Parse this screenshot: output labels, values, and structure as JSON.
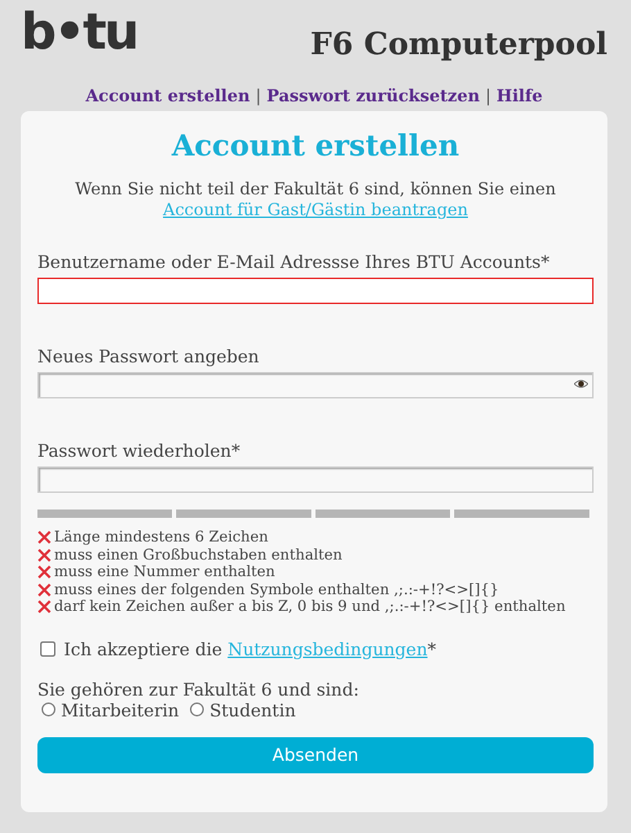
{
  "header": {
    "logo": "b•tu",
    "title": "F6 Computerpool"
  },
  "nav": [
    {
      "kind": "link",
      "text": "Account erstellen"
    },
    {
      "kind": "separator",
      "text": "|"
    },
    {
      "kind": "link",
      "text": "Passwort zurücksetzen"
    },
    {
      "kind": "separator",
      "text": "|"
    },
    {
      "kind": "link",
      "text": "Hilfe"
    }
  ],
  "form": {
    "title": "Account erstellen",
    "intro": {
      "text": "Wenn Sie nicht teil der Fakultät 6 sind, können Sie einen",
      "link": "Account für Gast/Gästin beantragen"
    },
    "fields": [
      {
        "label": "Benutzername oder E-Mail Adressse Ihres BTU Accounts*",
        "error": true,
        "show_toggle": false
      },
      {
        "label": "Neues Passwort angeben",
        "error": false,
        "show_toggle": true
      },
      {
        "label": "Passwort wiederholen*",
        "error": false,
        "show_toggle": false
      }
    ],
    "requirements": [
      {
        "text": "Länge mindestens 6 Zeichen",
        "met": false
      },
      {
        "text": "muss einen Großbuchstaben enthalten",
        "met": false
      },
      {
        "text": "muss eine Nummer enthalten",
        "met": false
      },
      {
        "text": "muss eines der folgenden Symbole enthalten ,;.:-+!?<>[]{}",
        "met": false
      },
      {
        "text": "darf kein Zeichen außer a bis Z, 0 bis 9 und ,;.:-+!?<>[]{} enthalten",
        "met": false
      }
    ],
    "terms": {
      "checked": false,
      "text": "Ich akzeptiere die",
      "link": "Nutzungsbedingungen",
      "suffix": "*"
    },
    "role_question": "Sie gehören zur Fakultät 6 und sind:",
    "roles": [
      {
        "label": "Mitarbeiterin",
        "selected": false
      },
      {
        "label": "Studentin",
        "selected": false
      }
    ],
    "submit": "Absenden"
  }
}
